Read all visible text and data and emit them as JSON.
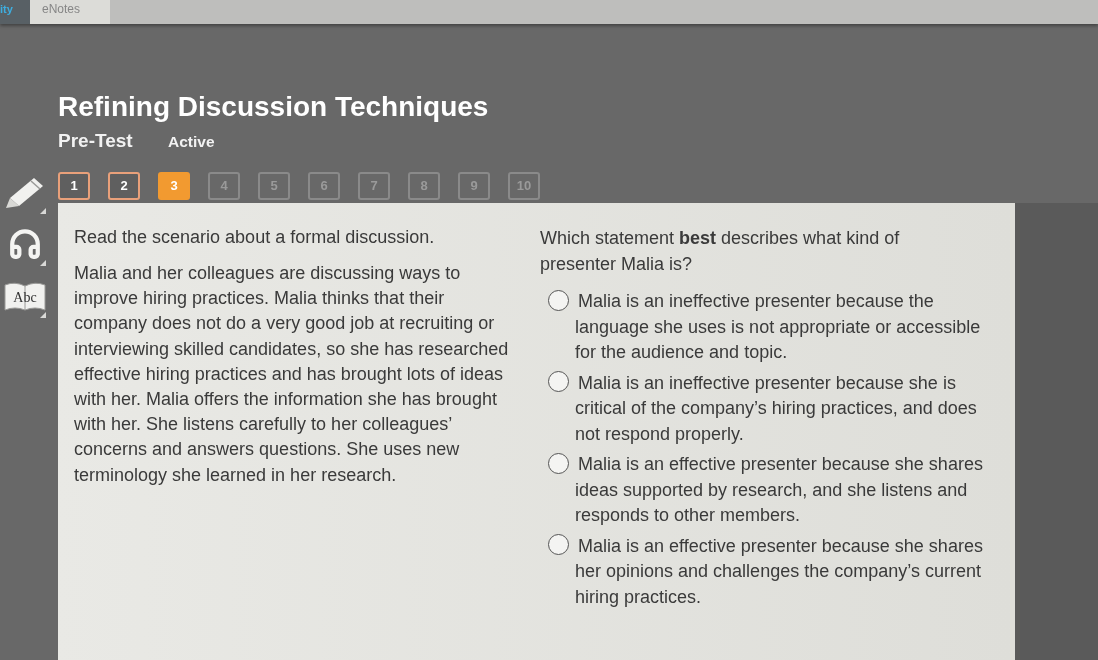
{
  "app_bar": {
    "cut_label": "ity",
    "tabs": [
      {
        "label": "eNotes",
        "selected": true
      }
    ]
  },
  "title": "Refining Discussion Techniques",
  "test": {
    "name": "Pre-Test",
    "status": "Active"
  },
  "tools": [
    {
      "kind": "pencil"
    },
    {
      "kind": "headphones"
    },
    {
      "kind": "dictionary",
      "label": "Abc"
    }
  ],
  "questions": [
    {
      "label": "1",
      "answered": true,
      "selected": false
    },
    {
      "label": "2",
      "answered": true,
      "selected": false
    },
    {
      "label": "3",
      "answered": false,
      "selected": true
    },
    {
      "label": "4",
      "answered": false,
      "selected": false
    },
    {
      "label": "5",
      "answered": false,
      "selected": false
    },
    {
      "label": "6",
      "answered": false,
      "selected": false
    },
    {
      "label": "7",
      "answered": false,
      "selected": false
    },
    {
      "label": "8",
      "answered": false,
      "selected": false
    },
    {
      "label": "9",
      "answered": false,
      "selected": false
    },
    {
      "label": "10",
      "answered": false,
      "selected": false
    }
  ],
  "passage": {
    "instruction": "Read the scenario about a formal discussion.",
    "text": "Malia and her colleagues are discussing ways to improve hiring practices. Malia thinks that their company does not do a very good job at recruiting or interviewing skilled candidates, so she has researched effective hiring practices and has brought lots of ideas with her. Malia offers the information she has brought with her. She listens carefully to her colleagues’ concerns and answers questions. She uses new terminology she learned in her research."
  },
  "question": {
    "prompt": "Which statement **best** describes what kind of presenter Malia is?",
    "options": [
      {
        "text": "Malia is an ineffective presenter because the language she uses is not appropriate or accessible for the audience and topic.",
        "selected": false
      },
      {
        "text": "Malia is an ineffective presenter because she is critical of the company’s hiring practices, and does not respond properly.",
        "selected": false
      },
      {
        "text": "Malia is an effective presenter because she shares ideas supported by research, and she listens and responds to other members.",
        "selected": false
      },
      {
        "text": "Malia is an effective presenter because she shares her opinions and challenges the company’s current hiring practices.",
        "selected": false
      }
    ]
  }
}
